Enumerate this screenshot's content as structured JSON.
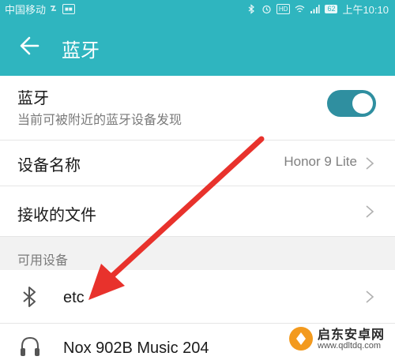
{
  "status_bar": {
    "carrier": "中国移动",
    "battery": "62",
    "time": "上午10:10"
  },
  "app_bar": {
    "title": "蓝牙"
  },
  "bluetooth_row": {
    "title": "蓝牙",
    "subtitle": "当前可被附近的蓝牙设备发现",
    "enabled": true
  },
  "device_name_row": {
    "label": "设备名称",
    "value": "Honor 9 Lite"
  },
  "received_files_row": {
    "label": "接收的文件"
  },
  "available_section": {
    "label": "可用设备",
    "devices": [
      {
        "name": "etc",
        "icon": "bluetooth-icon"
      },
      {
        "name": "Nox 902B Music 204",
        "icon": "headphones-icon"
      }
    ]
  },
  "colors": {
    "accent": "#2fb5bf",
    "toggle": "#2f8fa0",
    "annotation_arrow": "#e8322c"
  },
  "watermark": {
    "title": "启东安卓网",
    "url": "www.qdltdq.com"
  }
}
